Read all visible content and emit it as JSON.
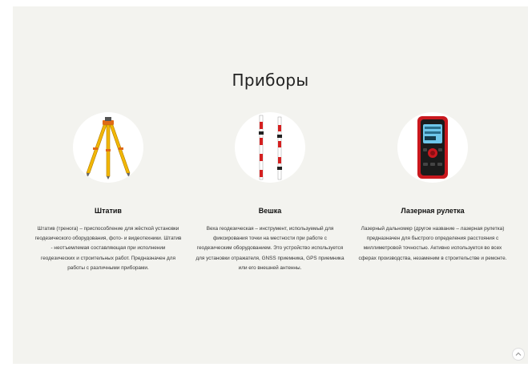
{
  "section": {
    "title": "Приборы"
  },
  "cards": [
    {
      "icon": "tripod-image",
      "title": "Штатив",
      "text": "Штатив (тренога) – приспособление для жёсткой установки геодезического оборудования, фото- и видеотехники. Штатив - неотъемлемая составляющая при исполнении геодезических и строительных работ. Предназначен для работы с различными приборами."
    },
    {
      "icon": "survey-pole-image",
      "title": "Вешка",
      "text": "Веха геодезическая – инструмент, используемый для фиксирования точки на местности при работе с геодезическим оборудованием. Это устройство используется для установки отражателя, GNSS приемника, GPS приемника или его внешней антенны."
    },
    {
      "icon": "laser-rangefinder-image",
      "title": "Лазерная рулетка",
      "text": "Лазерный дальномер (другое название – лазерная рулетка) предназначен для быстрого определения расстояния с миллиметровой точностью. Активно используется во всех сферах производства, незаменим в строительстве и ремонте."
    }
  ],
  "colors": {
    "background": "#f3f3ef",
    "tripod": "#f2b705",
    "pole_red": "#d42020",
    "device_red": "#c9181e"
  }
}
